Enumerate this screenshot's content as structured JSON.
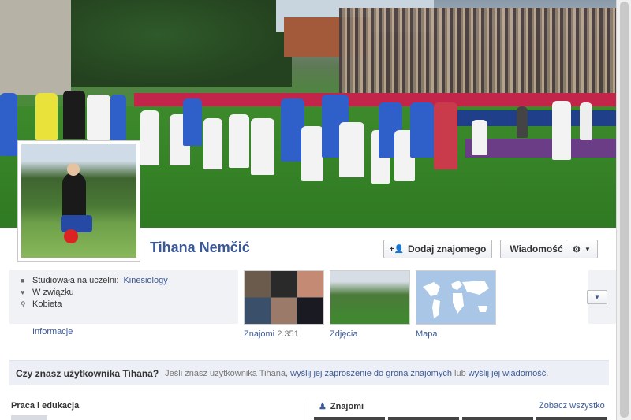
{
  "profile": {
    "name": "Tihana Nemčić"
  },
  "actions": {
    "add_friend_label": "Dodaj znajomego",
    "message_label": "Wiadomość"
  },
  "info": {
    "education_prefix": "Studiowała na uczelni:",
    "education_value": "Kinesiology",
    "relationship": "W związku",
    "gender": "Kobieta",
    "more_link": "Informacje"
  },
  "thumbs": {
    "friends_label": "Znajomi",
    "friends_count": "2.351",
    "photos_label": "Zdjęcia",
    "map_label": "Mapa"
  },
  "prompt": {
    "title": "Czy znasz użytkownika Tihana?",
    "text_1": "Jeśli znasz użytkownika Tihana,",
    "link_1": "wyślij jej zaproszenie do grona znajomych",
    "text_2": "lub",
    "link_2": "wyślij jej wiadomość",
    "text_3": "."
  },
  "sections": {
    "work_title": "Praca i edukacja",
    "friends_title": "Znajomi",
    "see_all": "Zobacz wszystko"
  },
  "colors": {
    "link": "#3b5998",
    "panel": "#f0f2f6"
  }
}
